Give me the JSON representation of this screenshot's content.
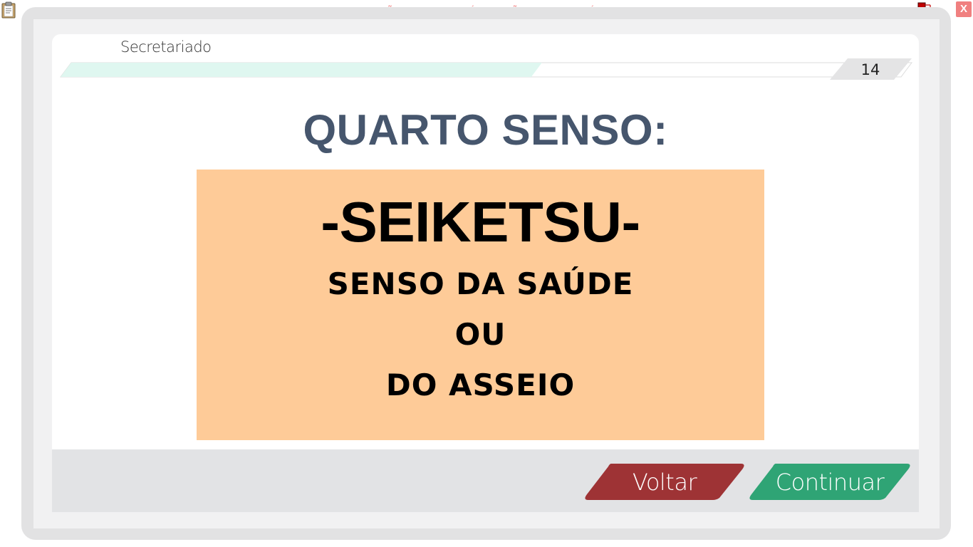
{
  "app": {
    "notice": "VERSÃO PARA FUNCIONÁRIOS - NÃO COMERCIALIZÁVEL",
    "close_label": "X"
  },
  "header": {
    "course_title": "Secretariado",
    "page_number": "14",
    "progress": 0.56
  },
  "slide": {
    "heading": "QUARTO SENSO:",
    "box_title": "-SEIKETSU-",
    "lines": [
      "SENSO DA SAÚDE",
      "OU",
      "DO ASSEIO"
    ]
  },
  "footer": {
    "back_label": "Voltar",
    "continue_label": "Continuar"
  },
  "colors": {
    "heading": "#46566d",
    "box": "#fecb98",
    "back_button": "#9e3335",
    "continue_button": "#2fa475",
    "progress_fill": "#dff7f0"
  },
  "icons": [
    "clipboard-icon",
    "network-status-icon",
    "close-icon"
  ]
}
